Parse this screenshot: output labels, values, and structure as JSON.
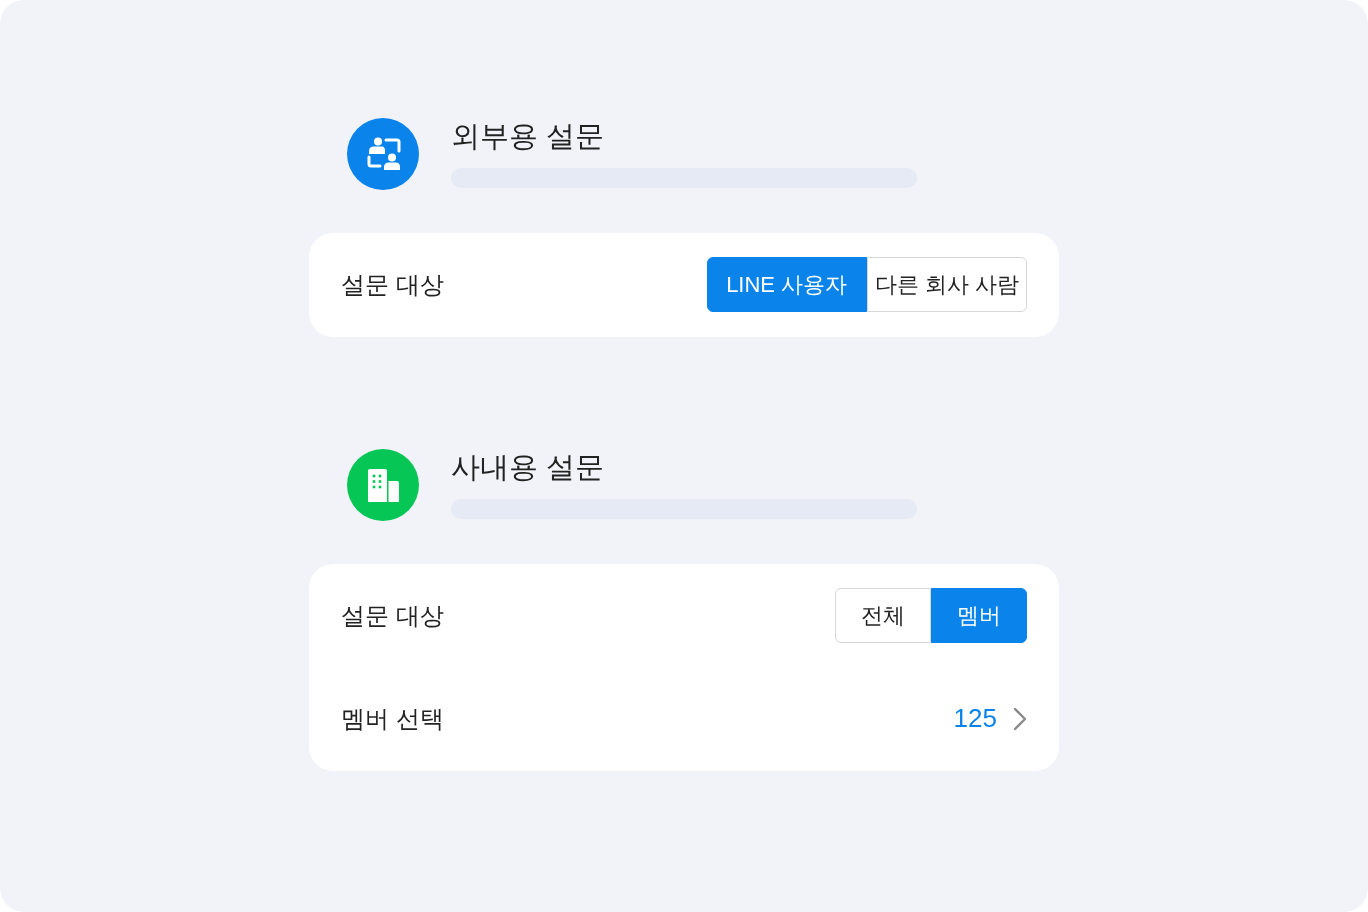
{
  "sections": [
    {
      "kind": "people",
      "color": "#0a84ea",
      "title": "외부용 설문",
      "rows": [
        {
          "kind": "segmented",
          "label": "설문 대상",
          "options": [
            {
              "label": "LINE 사용자",
              "selected": true
            },
            {
              "label": "다른 회사 사람",
              "selected": false
            }
          ]
        }
      ]
    },
    {
      "kind": "building",
      "color": "#06c755",
      "title": "사내용 설문",
      "rows": [
        {
          "kind": "segmented",
          "label": "설문 대상",
          "options": [
            {
              "label": "전체",
              "selected": false
            },
            {
              "label": "멤버",
              "selected": true
            }
          ]
        },
        {
          "kind": "link",
          "label": "멤버 선택",
          "value": "125"
        }
      ]
    }
  ]
}
